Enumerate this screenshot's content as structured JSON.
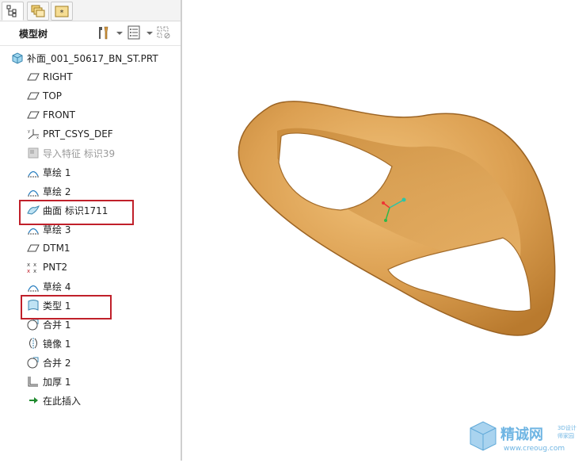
{
  "tabs": [
    {
      "icon": "tree-structure-icon"
    },
    {
      "icon": "layers-icon"
    },
    {
      "icon": "star-folder-icon"
    }
  ],
  "header": {
    "title": "模型树",
    "tools": [
      "settings-tools-icon",
      "tree-columns-icon",
      "filter-icon"
    ]
  },
  "tree": {
    "root": "补面_001_50617_BN_ST.PRT",
    "items": [
      {
        "label": "RIGHT",
        "icon": "datum-plane-icon"
      },
      {
        "label": "TOP",
        "icon": "datum-plane-icon"
      },
      {
        "label": "FRONT",
        "icon": "datum-plane-icon"
      },
      {
        "label": "PRT_CSYS_DEF",
        "icon": "coordinate-system-icon"
      },
      {
        "label": "导入特征 标识39",
        "icon": "import-feature-icon",
        "dim": true
      },
      {
        "label": "草绘 1",
        "icon": "sketch-icon"
      },
      {
        "label": "草绘 2",
        "icon": "sketch-icon"
      },
      {
        "label": "曲面 标识1711",
        "icon": "surface-icon"
      },
      {
        "label": "草绘 3",
        "icon": "sketch-icon"
      },
      {
        "label": "DTM1",
        "icon": "datum-plane-icon"
      },
      {
        "label": "PNT2",
        "icon": "datum-point-icon"
      },
      {
        "label": "草绘 4",
        "icon": "sketch-icon"
      },
      {
        "label": "类型 1",
        "icon": "boundary-blend-icon"
      },
      {
        "label": "合并 1",
        "icon": "merge-icon"
      },
      {
        "label": "镜像 1",
        "icon": "mirror-icon"
      },
      {
        "label": "合并 2",
        "icon": "merge-icon"
      },
      {
        "label": "加厚 1",
        "icon": "thicken-icon"
      },
      {
        "label": "在此插入",
        "icon": "insert-here-arrow-icon"
      }
    ]
  },
  "highlighted": [
    "曲面 标识1711",
    "类型 1"
  ],
  "watermark": {
    "name": "精诚网",
    "sub1": "3D设计",
    "sub2": "师家园",
    "url": "www.creoug.com"
  },
  "colors": {
    "highlight": "#c0202a",
    "model": "#d9993f",
    "accent": "#2a7fc0"
  }
}
